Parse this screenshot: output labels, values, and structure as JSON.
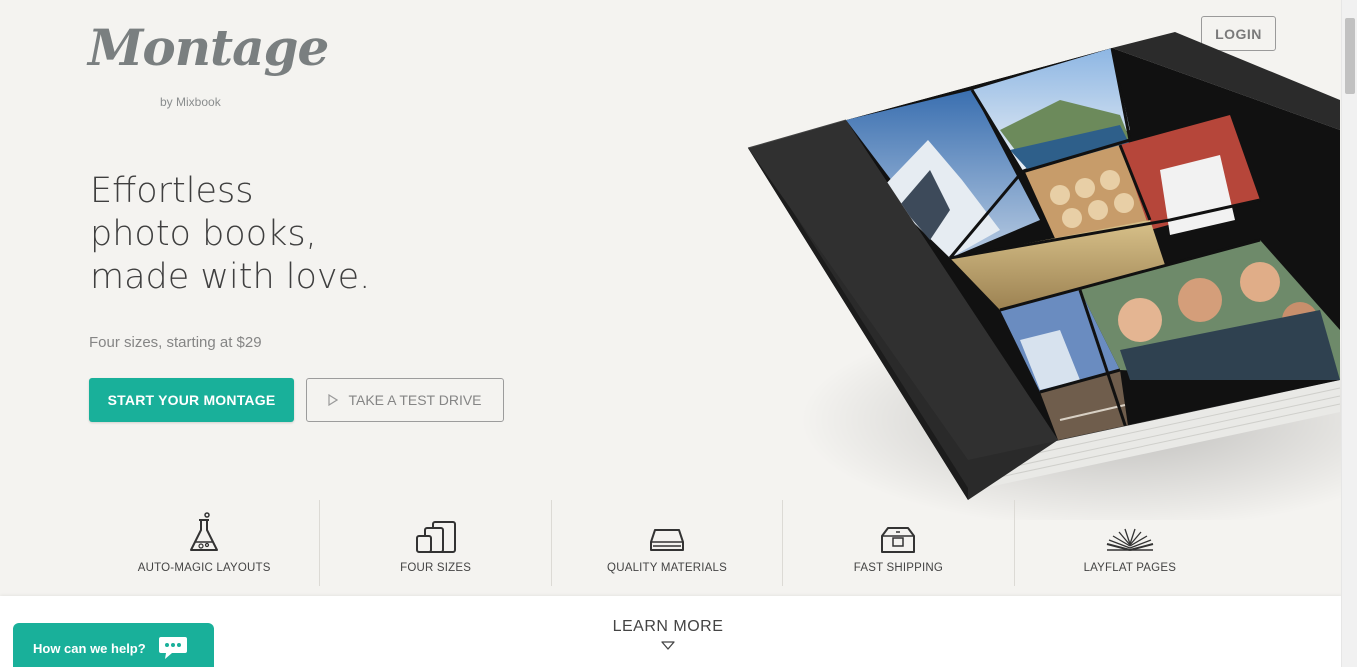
{
  "brand": {
    "logo_text": "Montage",
    "logo_sub": "by Mixbook"
  },
  "header": {
    "login_label": "LOGIN"
  },
  "hero": {
    "title_lines": [
      "Effortless",
      "photo books,",
      "made with love."
    ],
    "subtitle": "Four sizes, starting at $29",
    "primary_cta": "START YOUR MONTAGE",
    "secondary_cta": "TAKE A TEST DRIVE"
  },
  "features": [
    {
      "label": "AUTO-MAGIC LAYOUTS",
      "icon": "flask-icon"
    },
    {
      "label": "FOUR SIZES",
      "icon": "book-sizes-icon"
    },
    {
      "label": "QUALITY MATERIALS",
      "icon": "book-stack-icon"
    },
    {
      "label": "FAST SHIPPING",
      "icon": "box-icon"
    },
    {
      "label": "LAYFLAT PAGES",
      "icon": "open-book-icon"
    }
  ],
  "learn_more": {
    "label": "LEARN MORE"
  },
  "chat": {
    "label": "How can we help?"
  },
  "colors": {
    "accent": "#19b09a",
    "background": "#f4f3f0"
  }
}
